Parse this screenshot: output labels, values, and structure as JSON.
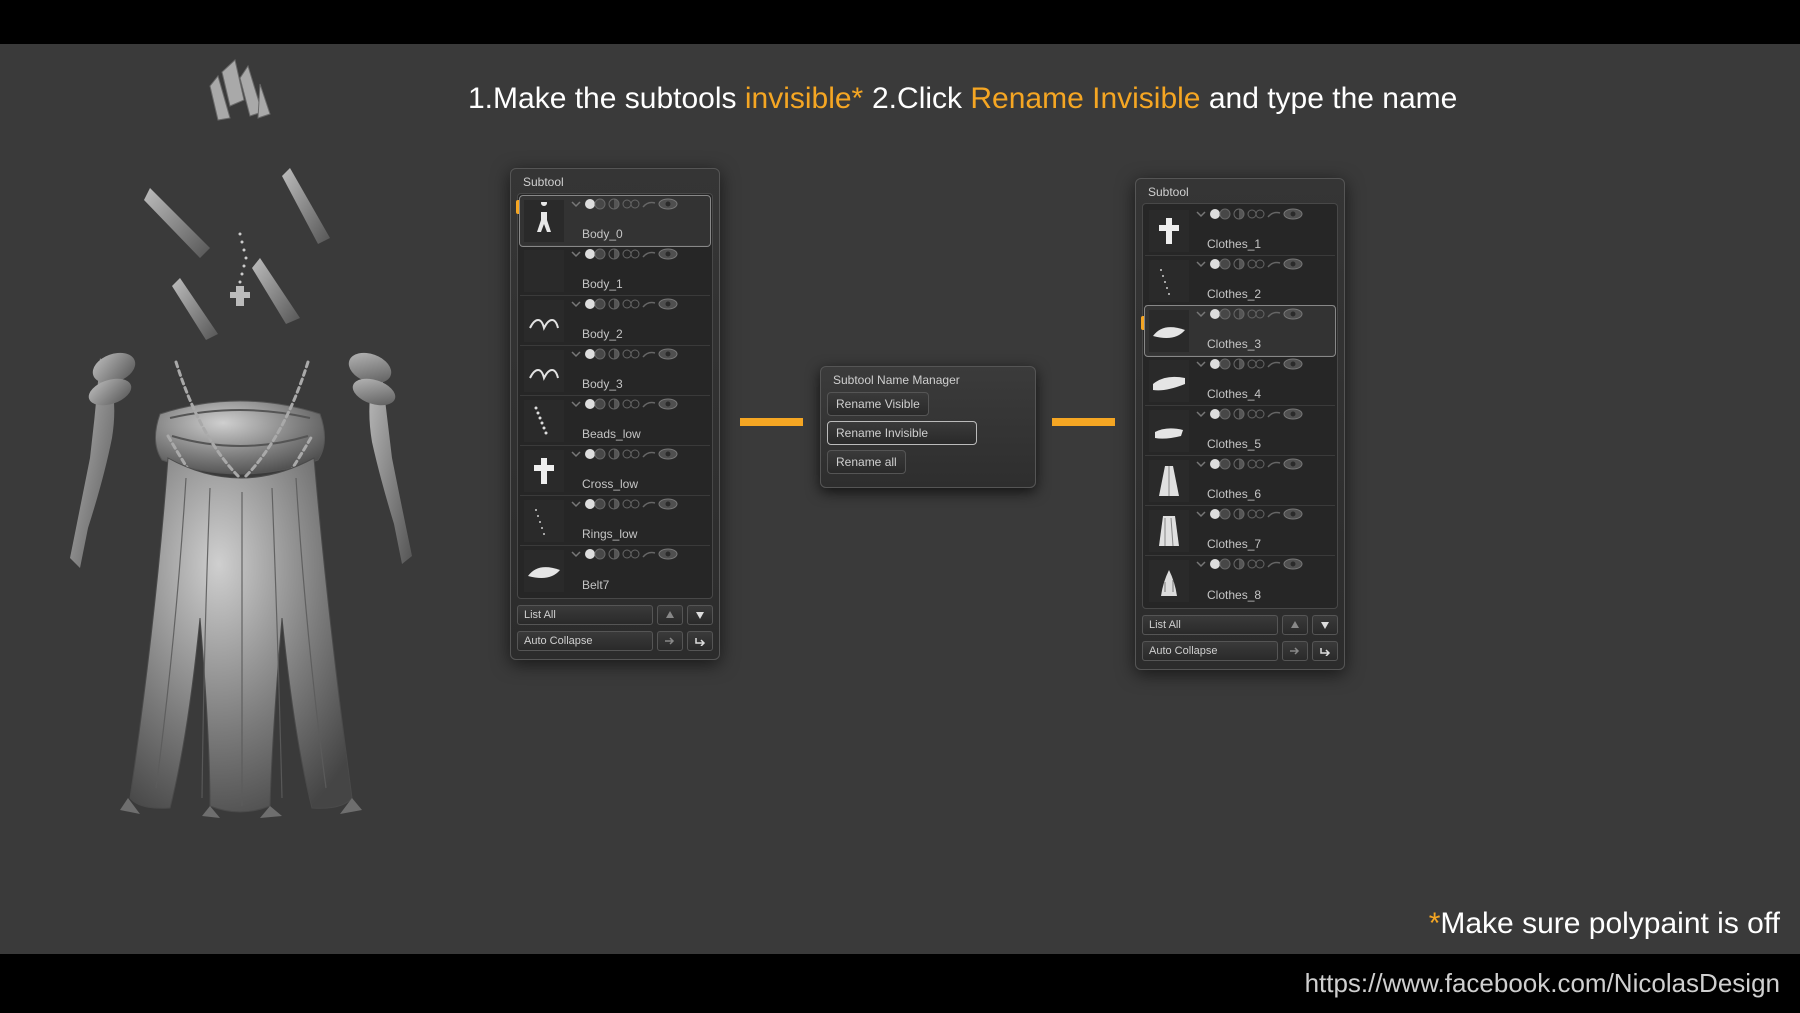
{
  "headings": {
    "step1_num": "1.",
    "step1_a": "Make the subtools ",
    "step1_b": "invisible*",
    "step2_num": "2.",
    "step2_a": "Click ",
    "step2_b": "Rename Invisible",
    "step2_c": " and type the name"
  },
  "footnote": {
    "star": "*",
    "text": "Make sure polypaint is off"
  },
  "url": "https://www.facebook.com/NicolasDesign",
  "panelA": {
    "title": "Subtool",
    "items": [
      {
        "label": "Body_0"
      },
      {
        "label": "Body_1"
      },
      {
        "label": "Body_2"
      },
      {
        "label": "Body_3"
      },
      {
        "label": "Beads_low"
      },
      {
        "label": "Cross_low"
      },
      {
        "label": "Rings_low"
      },
      {
        "label": "Belt7"
      }
    ],
    "listAll": "List All",
    "autoCollapse": "Auto Collapse"
  },
  "panelB": {
    "title": "Subtool",
    "items": [
      {
        "label": "Clothes_1"
      },
      {
        "label": "Clothes_2"
      },
      {
        "label": "Clothes_3"
      },
      {
        "label": "Clothes_4"
      },
      {
        "label": "Clothes_5"
      },
      {
        "label": "Clothes_6"
      },
      {
        "label": "Clothes_7"
      },
      {
        "label": "Clothes_8"
      }
    ],
    "listAll": "List All",
    "autoCollapse": "Auto Collapse"
  },
  "popup": {
    "title": "Subtool Name Manager",
    "opt1": "Rename Visible",
    "opt2": "Rename Invisible",
    "opt3": "Rename all"
  }
}
